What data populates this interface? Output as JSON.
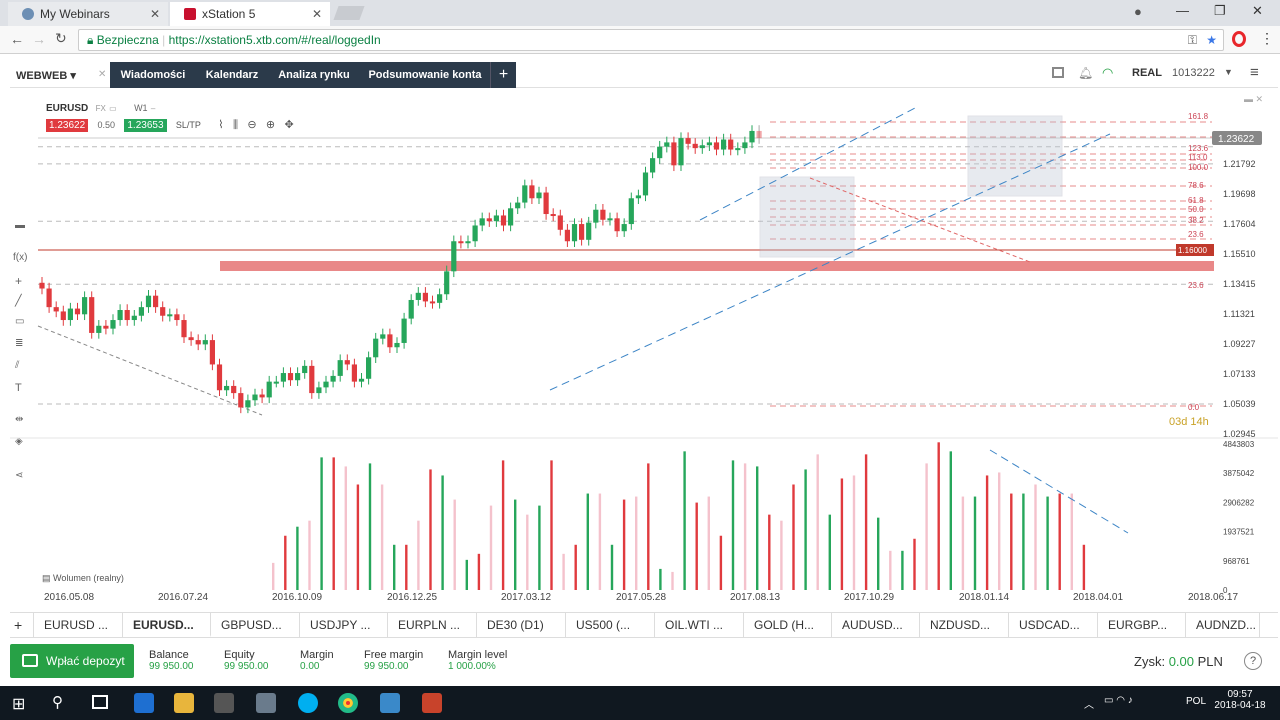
{
  "browser": {
    "tabs": [
      {
        "title": "My Webinars"
      },
      {
        "title": "xStation 5"
      }
    ],
    "secure_label": "Bezpieczna",
    "url": "https://xstation5.xtb.com/#/real/loggedIn"
  },
  "app": {
    "account_menu": "WEBWEB",
    "nav": [
      "Wiadomości",
      "Kalendarz",
      "Analiza rynku",
      "Podsumowanie konta"
    ],
    "add_label": "+",
    "mode": "REAL",
    "account_number": "1013222"
  },
  "chart": {
    "symbol": "EURUSD",
    "market": "FX",
    "interval": "W1",
    "bid": "1.23622",
    "spread": "0.50",
    "ask": "1.23653",
    "sltp": "SL/TP",
    "current_price": "1.23622",
    "alert_price": "1.16000",
    "countdown": "03d 14h",
    "volume_label": "Wolumen (realny)",
    "price_axis": [
      "1.21792",
      "1.19698",
      "1.17604",
      "1.15510",
      "1.13415",
      "1.11321",
      "1.09227",
      "1.07133",
      "1.05039",
      "1.02945"
    ],
    "volume_axis": [
      "4843803",
      "3875042",
      "2906282",
      "1937521",
      "968761",
      "0"
    ],
    "date_axis": [
      "2016.05.08",
      "2016.07.24",
      "2016.10.09",
      "2016.12.25",
      "2017.03.12",
      "2017.05.28",
      "2017.08.13",
      "2017.10.29",
      "2018.01.14",
      "2018.04.01",
      "2018.06.17"
    ],
    "fib_levels": [
      "161.8",
      "123.6",
      "113.0",
      "100.0",
      "78.6",
      "61.8",
      "50.0",
      "38.2",
      "23.6",
      "23.6",
      "0.0"
    ]
  },
  "instrument_tabs": [
    "EURUSD ...",
    "EURUSD...",
    "GBPUSD...",
    "USDJPY ...",
    "EURPLN ...",
    "DE30 (D1)",
    "US500 (...",
    "OIL.WTI ...",
    "GOLD (H...",
    "AUDUSD...",
    "NZDUSD...",
    "USDCAD...",
    "EURGBP...",
    "AUDNZD..."
  ],
  "account": {
    "deposit_label": "Wpłać depozyt",
    "balance_label": "Balance",
    "balance": "99 950.00",
    "equity_label": "Equity",
    "equity": "99 950.00",
    "margin_label": "Margin",
    "margin": "0.00",
    "free_margin_label": "Free margin",
    "free_margin": "99 950.00",
    "margin_level_label": "Margin level",
    "margin_level": "1 000.00%",
    "profit_label": "Zysk:",
    "profit": "0.00",
    "currency": "PLN"
  },
  "taskbar": {
    "lang": "POL",
    "time": "09:57",
    "date": "2018-04-18"
  },
  "colors": {
    "bull": "#26a65b",
    "bear": "#e03a3e",
    "nav": "#2b3a4a",
    "accent": "#27a146"
  }
}
